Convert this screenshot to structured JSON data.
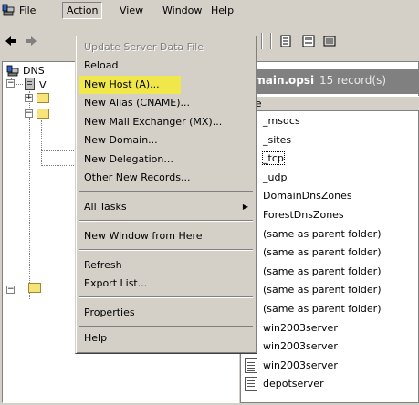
{
  "menubar": {
    "items": [
      "File",
      "Action",
      "View",
      "Window",
      "Help"
    ]
  },
  "action_menu": {
    "items": [
      {
        "label": "Update Server Data File",
        "disabled": true
      },
      {
        "label": "Reload"
      },
      {
        "label": "New Host (A)...",
        "highlighted": true
      },
      {
        "label": "New Alias (CNAME)..."
      },
      {
        "label": "New Mail Exchanger (MX)..."
      },
      {
        "label": "New Domain..."
      },
      {
        "label": "New Delegation..."
      },
      {
        "label": "Other New Records..."
      },
      {
        "label": "All Tasks",
        "submenu": true
      },
      {
        "label": "New Window from Here"
      },
      {
        "label": "Refresh"
      },
      {
        "label": "Export List..."
      },
      {
        "label": "Properties"
      },
      {
        "label": "Help"
      }
    ],
    "highlight_color": "#f0e84a"
  },
  "tree": {
    "root_label": "DNS",
    "server_initial": "V"
  },
  "right_pane": {
    "title": "omain.opsi",
    "count": "15 record(s)",
    "column_header": "me",
    "rows": [
      {
        "name": "_msdcs",
        "icon": "folder-icon"
      },
      {
        "name": "_sites",
        "icon": "folder-icon"
      },
      {
        "name": "_tcp",
        "icon": "folder-icon",
        "focused": true
      },
      {
        "name": "_udp",
        "icon": "folder-icon"
      },
      {
        "name": "DomainDnsZones",
        "icon": "folder-icon"
      },
      {
        "name": "ForestDnsZones",
        "icon": "folder-icon"
      },
      {
        "name": "(same as parent folder)",
        "icon": "record-icon"
      },
      {
        "name": "(same as parent folder)",
        "icon": "record-icon"
      },
      {
        "name": "(same as parent folder)",
        "icon": "record-icon"
      },
      {
        "name": "(same as parent folder)",
        "icon": "record-icon"
      },
      {
        "name": "(same as parent folder)",
        "icon": "record-icon"
      },
      {
        "name": "win2003server",
        "icon": "record-icon"
      },
      {
        "name": "win2003server",
        "icon": "record-icon"
      },
      {
        "name": "win2003server",
        "icon": "record-icon"
      },
      {
        "name": "depotserver",
        "icon": "record-icon"
      }
    ]
  }
}
